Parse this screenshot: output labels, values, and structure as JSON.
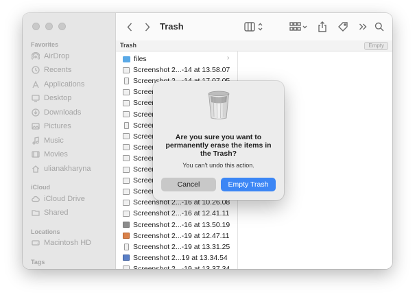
{
  "window": {
    "title": "Trash"
  },
  "sidebar": {
    "favorites_header": "Favorites",
    "favorites": [
      {
        "label": "AirDrop",
        "icon": "airdrop-icon"
      },
      {
        "label": "Recents",
        "icon": "clock-icon"
      },
      {
        "label": "Applications",
        "icon": "applications-icon"
      },
      {
        "label": "Desktop",
        "icon": "desktop-icon"
      },
      {
        "label": "Downloads",
        "icon": "downloads-icon"
      },
      {
        "label": "Pictures",
        "icon": "pictures-icon"
      },
      {
        "label": "Music",
        "icon": "music-icon"
      },
      {
        "label": "Movies",
        "icon": "movies-icon"
      },
      {
        "label": "ulianakharyna",
        "icon": "home-icon"
      }
    ],
    "icloud_header": "iCloud",
    "icloud": [
      {
        "label": "iCloud Drive",
        "icon": "cloud-icon"
      },
      {
        "label": "Shared",
        "icon": "shared-folder-icon"
      }
    ],
    "locations_header": "Locations",
    "locations": [
      {
        "label": "Macintosh HD",
        "icon": "disk-icon"
      }
    ],
    "tags_header": "Tags"
  },
  "toolbar": {
    "back_icon": "chevron-left-icon",
    "forward_icon": "chevron-right-icon",
    "view_icon": "column-view-icon",
    "group_icon": "grid-group-icon",
    "share_icon": "share-icon",
    "tag_icon": "tag-icon",
    "more_icon": "double-chevron-icon",
    "search_icon": "search-icon"
  },
  "pathbar": {
    "label": "Trash",
    "empty_button": "Empty"
  },
  "files": [
    {
      "name": "files",
      "kind": "folder"
    },
    {
      "name": "Screenshot 2...-14 at 13.58.07",
      "kind": "light"
    },
    {
      "name": "Screenshot 2...-14 at 17.07.05",
      "kind": "tall"
    },
    {
      "name": "Screensh",
      "kind": "light"
    },
    {
      "name": "Screensh",
      "kind": "light"
    },
    {
      "name": "Screensh",
      "kind": "light"
    },
    {
      "name": "Screensh",
      "kind": "tall"
    },
    {
      "name": "Screensh",
      "kind": "light"
    },
    {
      "name": "Screensh",
      "kind": "light"
    },
    {
      "name": "Screensh",
      "kind": "light"
    },
    {
      "name": "Screensh",
      "kind": "light"
    },
    {
      "name": "Screensh",
      "kind": "light"
    },
    {
      "name": "Screensh",
      "kind": "light"
    },
    {
      "name": "Screenshot 2...-16 at 10.26.08",
      "kind": "light"
    },
    {
      "name": "Screenshot 2...-16 at 12.41.11",
      "kind": "light"
    },
    {
      "name": "Screenshot 2...-16 at 13.50.19",
      "kind": "grey"
    },
    {
      "name": "Screenshot 2...-19 at 12.47.11",
      "kind": "orange"
    },
    {
      "name": "Screenshot 2...-19 at 13.31.25",
      "kind": "tall"
    },
    {
      "name": "Screenshot 2...19 at 13.34.54",
      "kind": "blue"
    },
    {
      "name": "Screenshot 2...-19 at 13.37.34",
      "kind": "light"
    }
  ],
  "dialog": {
    "icon": "trash-can-icon",
    "title": "Are you sure you want to permanently erase the items in the Trash?",
    "message": "You can't undo this action.",
    "cancel_label": "Cancel",
    "confirm_label": "Empty Trash",
    "accent": "#3c86f5"
  }
}
